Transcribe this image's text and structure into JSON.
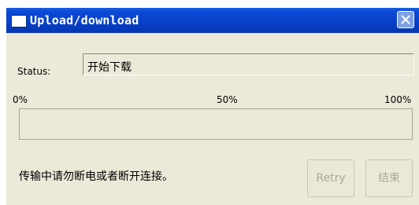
{
  "window": {
    "title": "Upload/download",
    "title_icon": "window-icon",
    "close_icon": "close-icon"
  },
  "status": {
    "label": "Status:",
    "value": "开始下载"
  },
  "progress": {
    "scale_start": "0%",
    "scale_mid": "50%",
    "scale_end": "100%",
    "value_percent": 0
  },
  "message": "传输中请勿断电或者断开连接。",
  "buttons": {
    "retry": "Retry",
    "finish": "结束"
  },
  "colors": {
    "titlebar": "#0a49d6",
    "dialog_bg": "#ece9d8",
    "disabled_text": "#aca899"
  }
}
